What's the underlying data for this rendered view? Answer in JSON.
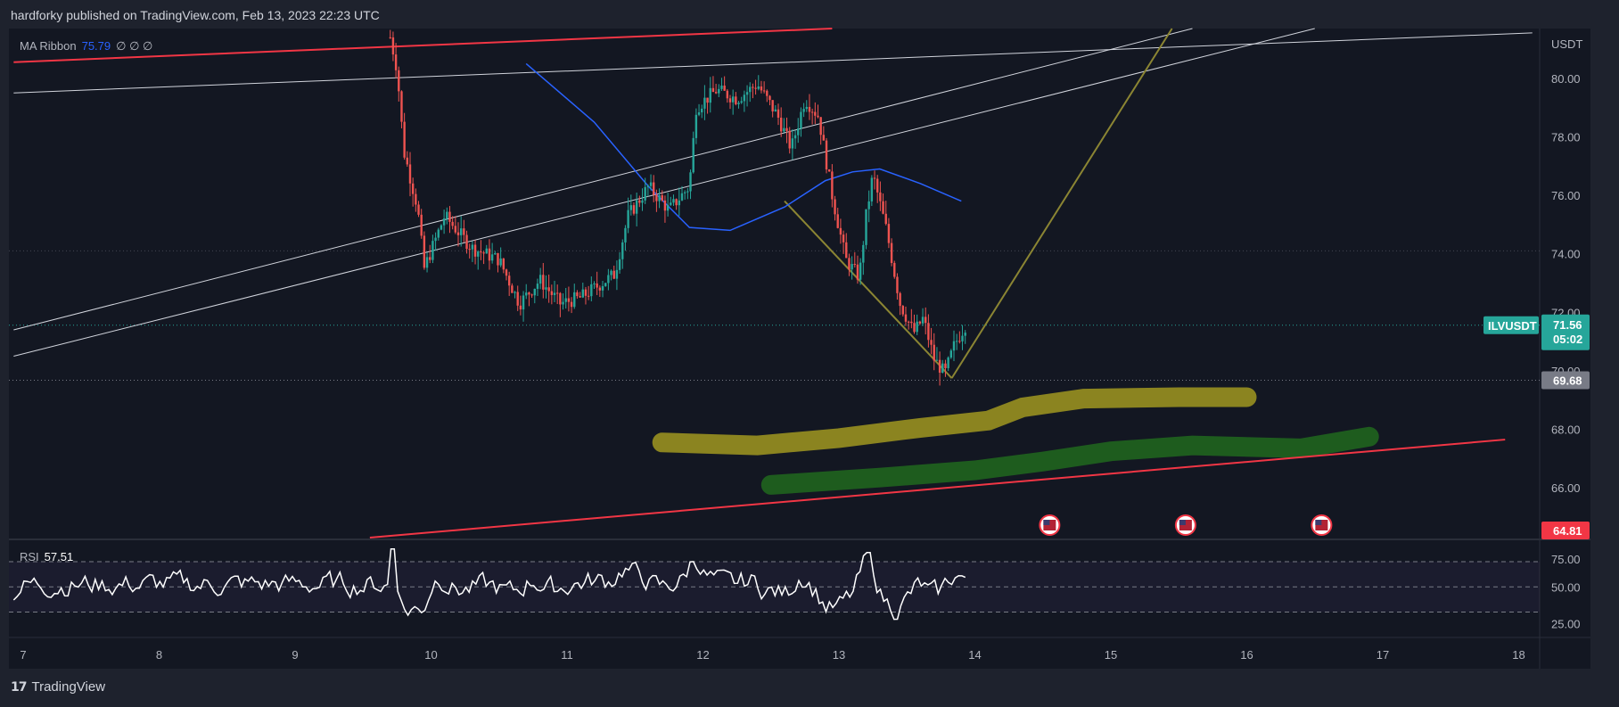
{
  "header": {
    "published": "hardforky published on TradingView.com, Feb 13, 2023 22:23 UTC"
  },
  "footer": {
    "brand": "TradingView",
    "logo_icon": "tv-logo-icon"
  },
  "main_legend": {
    "name": "MA Ribbon",
    "value": "75.79",
    "zeros": "∅  ∅  ∅"
  },
  "rsi_legend": {
    "name": "RSI",
    "value": "57.51"
  },
  "price_axis": {
    "unit": "USDT",
    "ticks": [
      "80.00",
      "78.00",
      "76.00",
      "74.00",
      "72.00",
      "70.00",
      "68.00",
      "66.00"
    ],
    "symbol_tag": {
      "symbol": "ILVUSDT",
      "price": "71.56",
      "countdown": "05:02",
      "color": "#26a69a"
    },
    "low_tag": {
      "price": "69.68",
      "color": "#787b86"
    },
    "line_tag": {
      "price": "64.81",
      "color": "#f23645"
    }
  },
  "rsi_axis": {
    "ticks": [
      "75.00",
      "50.00",
      "25.00"
    ]
  },
  "time_axis": {
    "ticks": [
      "7",
      "8",
      "9",
      "10",
      "11",
      "12",
      "13",
      "14",
      "15",
      "16",
      "17",
      "18"
    ]
  },
  "events": {
    "icon": "us-flag-icon",
    "count": 3
  },
  "colors": {
    "up": "#26a69a",
    "down": "#ef5350",
    "ma": "#2962ff",
    "channel": "#f23645",
    "trend": "#d1d4dc",
    "projection": "#8b8533",
    "zone_yellow": "#8b8420",
    "zone_green": "#1e5c1e"
  },
  "chart_data": {
    "type": "candlestick",
    "symbol": "ILVUSDT",
    "ylim": [
      64.3,
      81.7
    ],
    "x_ticks": [
      "7",
      "8",
      "9",
      "10",
      "11",
      "12",
      "13",
      "14",
      "15",
      "16",
      "17",
      "18"
    ],
    "last_price": 71.56,
    "marked_low": 69.68,
    "ma_ribbon": [
      [
        10.7,
        80.5
      ],
      [
        11.2,
        78.5
      ],
      [
        11.6,
        76.3
      ],
      [
        11.9,
        74.9
      ],
      [
        12.2,
        74.8
      ],
      [
        12.6,
        75.6
      ],
      [
        12.9,
        76.5
      ],
      [
        13.1,
        76.8
      ],
      [
        13.3,
        76.9
      ],
      [
        13.6,
        76.4
      ],
      [
        13.9,
        75.8
      ]
    ],
    "price_path": [
      [
        9.7,
        81.4
      ],
      [
        9.75,
        80.3
      ],
      [
        9.8,
        77.5
      ],
      [
        9.9,
        75.6
      ],
      [
        9.95,
        73.5
      ],
      [
        10.1,
        75.3
      ],
      [
        10.3,
        74.2
      ],
      [
        10.5,
        73.8
      ],
      [
        10.65,
        72.3
      ],
      [
        10.8,
        73.1
      ],
      [
        10.95,
        72.3
      ],
      [
        11.1,
        72.5
      ],
      [
        11.35,
        73.3
      ],
      [
        11.45,
        75.3
      ],
      [
        11.6,
        76.3
      ],
      [
        11.75,
        75.5
      ],
      [
        11.9,
        76.3
      ],
      [
        11.95,
        79.0
      ],
      [
        12.1,
        79.6
      ],
      [
        12.25,
        79.3
      ],
      [
        12.4,
        79.8
      ],
      [
        12.55,
        78.7
      ],
      [
        12.65,
        77.6
      ],
      [
        12.75,
        79.3
      ],
      [
        12.85,
        78.7
      ],
      [
        12.95,
        76.0
      ],
      [
        13.05,
        73.8
      ],
      [
        13.15,
        73.2
      ],
      [
        13.2,
        75.3
      ],
      [
        13.25,
        76.7
      ],
      [
        13.35,
        74.8
      ],
      [
        13.45,
        72.3
      ],
      [
        13.55,
        71.3
      ],
      [
        13.62,
        71.8
      ],
      [
        13.7,
        70.4
      ],
      [
        13.78,
        69.9
      ],
      [
        13.85,
        70.9
      ],
      [
        13.93,
        71.56
      ]
    ],
    "rsi": {
      "value": 57.51,
      "levels": [
        70,
        50,
        30
      ],
      "ylim": [
        12,
        82
      ]
    }
  }
}
